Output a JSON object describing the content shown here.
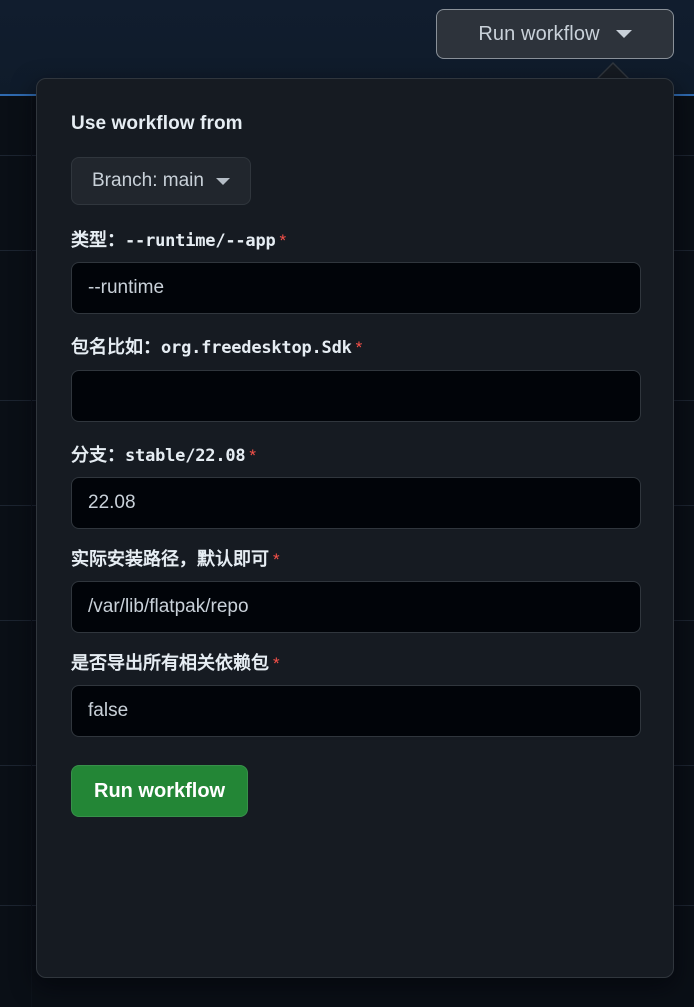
{
  "trigger": {
    "label": "Run workflow",
    "caret_icon": "chevron-down-icon"
  },
  "popover": {
    "title": "Use workflow from",
    "branch_selector": {
      "label": "Branch: main",
      "caret_icon": "chevron-down-icon"
    },
    "fields": [
      {
        "id": "type",
        "label_text": "类型：",
        "label_mono": "--runtime/--app",
        "required_marker": "*",
        "value": "--runtime",
        "placeholder": ""
      },
      {
        "id": "package",
        "label_text": "包名比如：",
        "label_mono": "org.freedesktop.Sdk",
        "required_marker": "*",
        "value": "",
        "placeholder": ""
      },
      {
        "id": "branch",
        "label_text": "分支：",
        "label_mono": "stable/22.08",
        "required_marker": "*",
        "value": "22.08",
        "placeholder": ""
      },
      {
        "id": "install-path",
        "label_text": "实际安装路径，默认即可",
        "label_mono": "",
        "required_marker": "*",
        "value": "/var/lib/flatpak/repo",
        "placeholder": ""
      },
      {
        "id": "export-deps",
        "label_text": "是否导出所有相关依赖包",
        "label_mono": "",
        "required_marker": "*",
        "value": "false",
        "placeholder": ""
      }
    ],
    "submit_label": "Run workflow"
  },
  "colors": {
    "accent_green": "#238636",
    "required_red": "#f85149",
    "popover_bg": "#161b22",
    "input_bg": "#010409",
    "border": "#30363d",
    "header_rule_blue": "#2f6ab0"
  }
}
